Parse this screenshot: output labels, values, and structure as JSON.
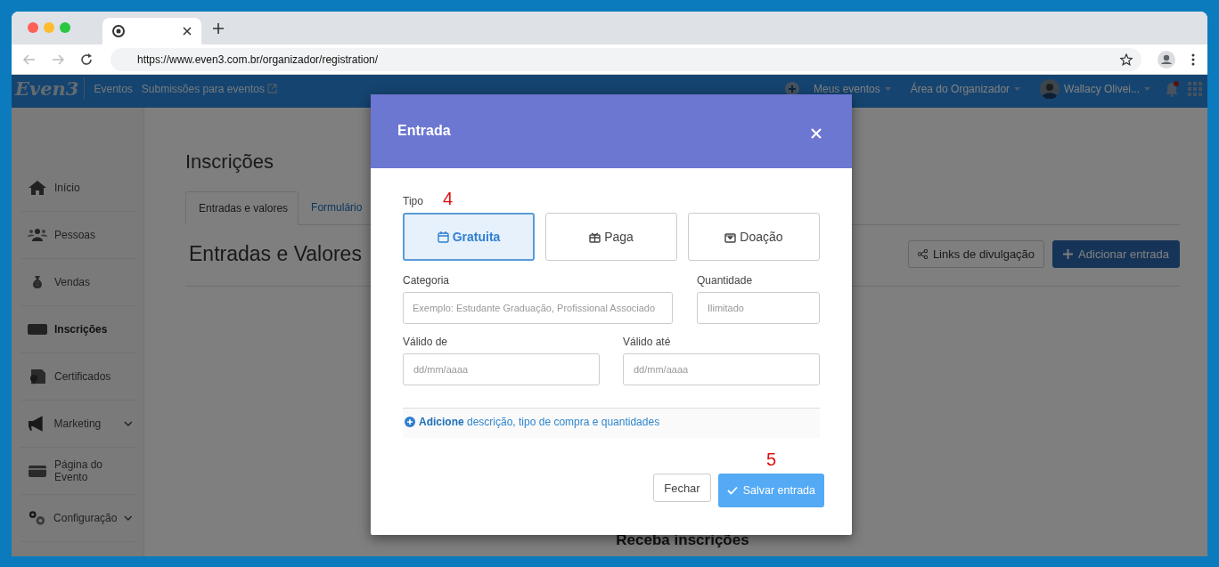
{
  "browser": {
    "address": "https://www.even3.com.br/organizador/registration/"
  },
  "nav": {
    "logo": "Even3",
    "section": "Eventos",
    "link": "Submissões para eventos",
    "menus": [
      "Meus eventos",
      "Área do Organizador"
    ],
    "user": "Wallacy Olivei..."
  },
  "sidebar": {
    "items": [
      {
        "label": "Início",
        "selected": false,
        "expandable": false
      },
      {
        "label": "Pessoas",
        "selected": false,
        "expandable": false
      },
      {
        "label": "Vendas",
        "selected": false,
        "expandable": false
      },
      {
        "label": "Inscrições",
        "selected": true,
        "expandable": false
      },
      {
        "label": "Certificados",
        "selected": false,
        "expandable": false
      },
      {
        "label": "Marketing",
        "selected": false,
        "expandable": true
      },
      {
        "label": "Página do Evento",
        "selected": false,
        "expandable": false
      },
      {
        "label": "Configuração",
        "selected": false,
        "expandable": true
      }
    ]
  },
  "page": {
    "title": "Inscrições",
    "tabs": [
      {
        "label": "Entradas e valores",
        "selected": true
      },
      {
        "label": "Formulário",
        "selected": false
      }
    ],
    "section_title": "Entradas e Valores",
    "buttons": [
      "Links de divulgação",
      "Adicionar entrada"
    ],
    "footer_heading": "Receba inscrições"
  },
  "modal": {
    "title": "Entrada",
    "type_label": "Tipo",
    "types": [
      {
        "label": "Gratuita",
        "selected": true
      },
      {
        "label": "Paga",
        "selected": false
      },
      {
        "label": "Doação",
        "selected": false
      }
    ],
    "fields": [
      {
        "label": "Categoria",
        "placeholder": "Exemplo: Estudante Graduação, Profissional Associado"
      },
      {
        "label": "Quantidade",
        "placeholder": "Ilimitado"
      },
      {
        "label": "Válido de",
        "placeholder": "dd/mm/aaaa"
      },
      {
        "label": "Válido até",
        "placeholder": "dd/mm/aaaa"
      }
    ],
    "add_link": "**Adicione** descrição, tipo de compra e quantidades",
    "buttons": [
      "Fechar",
      "Salvar entrada"
    ]
  },
  "annotations": [
    "4",
    "5"
  ]
}
